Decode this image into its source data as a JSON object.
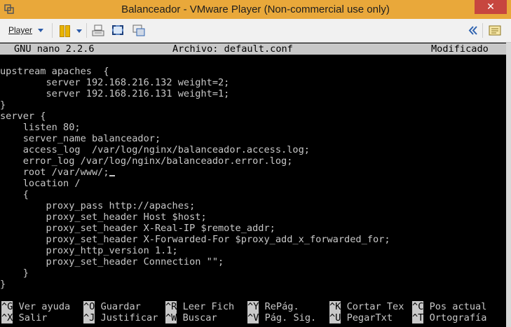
{
  "window": {
    "title": "Balanceador - VMware Player (Non-commercial use only)",
    "close_glyph": "✕"
  },
  "toolbar": {
    "player_label": "Player",
    "icons": [
      "pause-icon",
      "send-ctrl-alt-del-icon",
      "full-screen-icon",
      "unity-icon",
      "collapse-icon",
      "message-log-icon"
    ]
  },
  "nano": {
    "version": "GNU nano 2.2.6",
    "filename": "Archivo: default.conf",
    "status": "Modificado",
    "lines": [
      "",
      "upstream apaches  {",
      "        server 192.168.216.132 weight=2;",
      "        server 192.168.216.131 weight=1;",
      "}",
      "server {",
      "    listen 80;",
      "    server_name balanceador;",
      "    access_log  /var/log/nginx/balanceador.access.log;",
      "    error_log /var/log/nginx/balanceador.error.log;",
      "    root /var/www/;",
      "    location /",
      "    {",
      "        proxy_pass http://apaches;",
      "        proxy_set_header Host $host;",
      "        proxy_set_header X-Real-IP $remote_addr;",
      "        proxy_set_header X-Forwarded-For $proxy_add_x_forwarded_for;",
      "        proxy_http_version 1.1;",
      "        proxy_set_header Connection \"\";",
      "    }",
      "}"
    ],
    "shortcuts_row1": [
      {
        "key": "^G",
        "label": "Ver ayuda"
      },
      {
        "key": "^O",
        "label": "Guardar"
      },
      {
        "key": "^R",
        "label": "Leer Fich"
      },
      {
        "key": "^Y",
        "label": "RePág."
      },
      {
        "key": "^K",
        "label": "Cortar Tex"
      },
      {
        "key": "^C",
        "label": "Pos actual"
      }
    ],
    "shortcuts_row2": [
      {
        "key": "^X",
        "label": "Salir"
      },
      {
        "key": "^J",
        "label": "Justificar"
      },
      {
        "key": "^W",
        "label": "Buscar"
      },
      {
        "key": "^V",
        "label": "Pág. Sig."
      },
      {
        "key": "^U",
        "label": "PegarTxt"
      },
      {
        "key": "^T",
        "label": "Ortografía"
      }
    ]
  },
  "colors": {
    "titlebar": "#e9a83a",
    "terminal_bg": "#000000",
    "terminal_fg": "#c8c8c8",
    "close_button": "#c7463f"
  }
}
